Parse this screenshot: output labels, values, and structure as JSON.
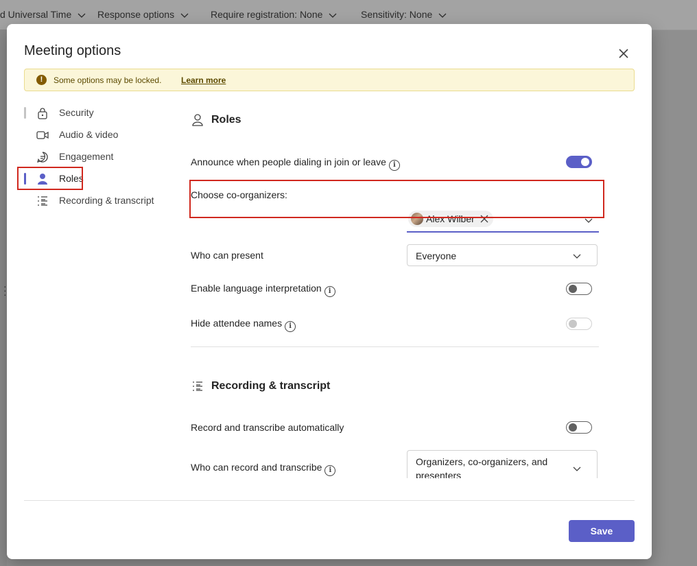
{
  "background_toolbar": {
    "items": [
      {
        "label": "d Universal Time"
      },
      {
        "label": "Response options"
      },
      {
        "label": "Require registration: None"
      },
      {
        "label": "Sensitivity: None"
      }
    ]
  },
  "dialog": {
    "title": "Meeting options",
    "close_icon": "close-icon",
    "banner": {
      "text": "Some options may be locked.",
      "link": "Learn more",
      "icon": "warning-icon"
    },
    "nav": {
      "items": [
        {
          "label": "Security",
          "icon": "lock-icon"
        },
        {
          "label": "Audio & video",
          "icon": "video-camera-icon"
        },
        {
          "label": "Engagement",
          "icon": "chat-icon"
        },
        {
          "label": "Roles",
          "icon": "person-icon",
          "active": true
        },
        {
          "label": "Recording & transcript",
          "icon": "list-icon"
        }
      ]
    },
    "roles": {
      "title": "Roles",
      "announce_label": "Announce when people dialing in join or leave",
      "announce_on": true,
      "co_organizers_label": "Choose co-organizers:",
      "co_organizer_chip": "Alex Wilber",
      "who_can_present_label": "Who can present",
      "who_can_present_value": "Everyone",
      "language_interp_label": "Enable language interpretation",
      "language_interp_on": false,
      "hide_names_label": "Hide attendee names",
      "hide_names_on": false
    },
    "recording": {
      "title": "Recording & transcript",
      "auto_label": "Record and transcribe automatically",
      "auto_on": false,
      "who_can_record_label": "Who can record and transcribe",
      "who_can_record_value_line1": "Organizers, co-organizers, and",
      "who_can_record_value_line2": "presenters"
    },
    "save_label": "Save"
  },
  "colors": {
    "accent": "#5b5fc7",
    "highlight_box": "#d0281e",
    "banner_bg": "#fbf6d9"
  }
}
